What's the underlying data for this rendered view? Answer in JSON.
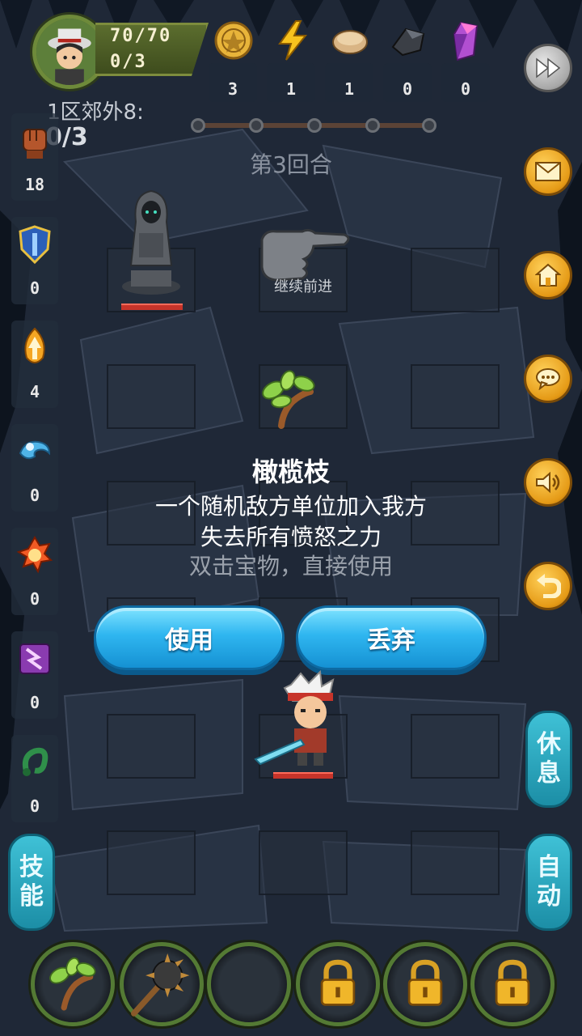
{
  "player": {
    "hp": "70/70",
    "wave": "0/3"
  },
  "resources": [
    {
      "icon": "gold-coin-icon",
      "value": "3"
    },
    {
      "icon": "lightning-icon",
      "value": "1"
    },
    {
      "icon": "bread-icon",
      "value": "1"
    },
    {
      "icon": "iron-ore-icon",
      "value": "0"
    },
    {
      "icon": "purple-crystal-icon",
      "value": "0"
    }
  ],
  "stage": {
    "label": "1区郊外8:",
    "progress": "0/3",
    "round": "第3回合"
  },
  "skills": [
    {
      "icon": "fist-icon",
      "count": "18"
    },
    {
      "icon": "shield-icon",
      "count": "0"
    },
    {
      "icon": "fire-arrow-icon",
      "count": "4"
    },
    {
      "icon": "water-wave-icon",
      "count": "0"
    },
    {
      "icon": "fireball-icon",
      "count": "0"
    },
    {
      "icon": "lightning-rune-icon",
      "count": "0"
    },
    {
      "icon": "serpent-icon",
      "count": "0"
    }
  ],
  "board": {
    "continue_label": "继续前进"
  },
  "item": {
    "name": "橄榄枝",
    "desc_line1": "一个随机敌方单位加入我方",
    "desc_line2": "失去所有愤怒之力",
    "hint": "双击宝物，直接使用",
    "use_label": "使用",
    "discard_label": "丢弃"
  },
  "side_buttons": {
    "skills": [
      "技",
      "能"
    ],
    "rest": [
      "休",
      "息"
    ],
    "auto": [
      "自",
      "动"
    ]
  },
  "colors": {
    "accent_blue": "#2fb6f0",
    "accent_orange": "#e59a16",
    "hp_red": "#c7342a"
  }
}
